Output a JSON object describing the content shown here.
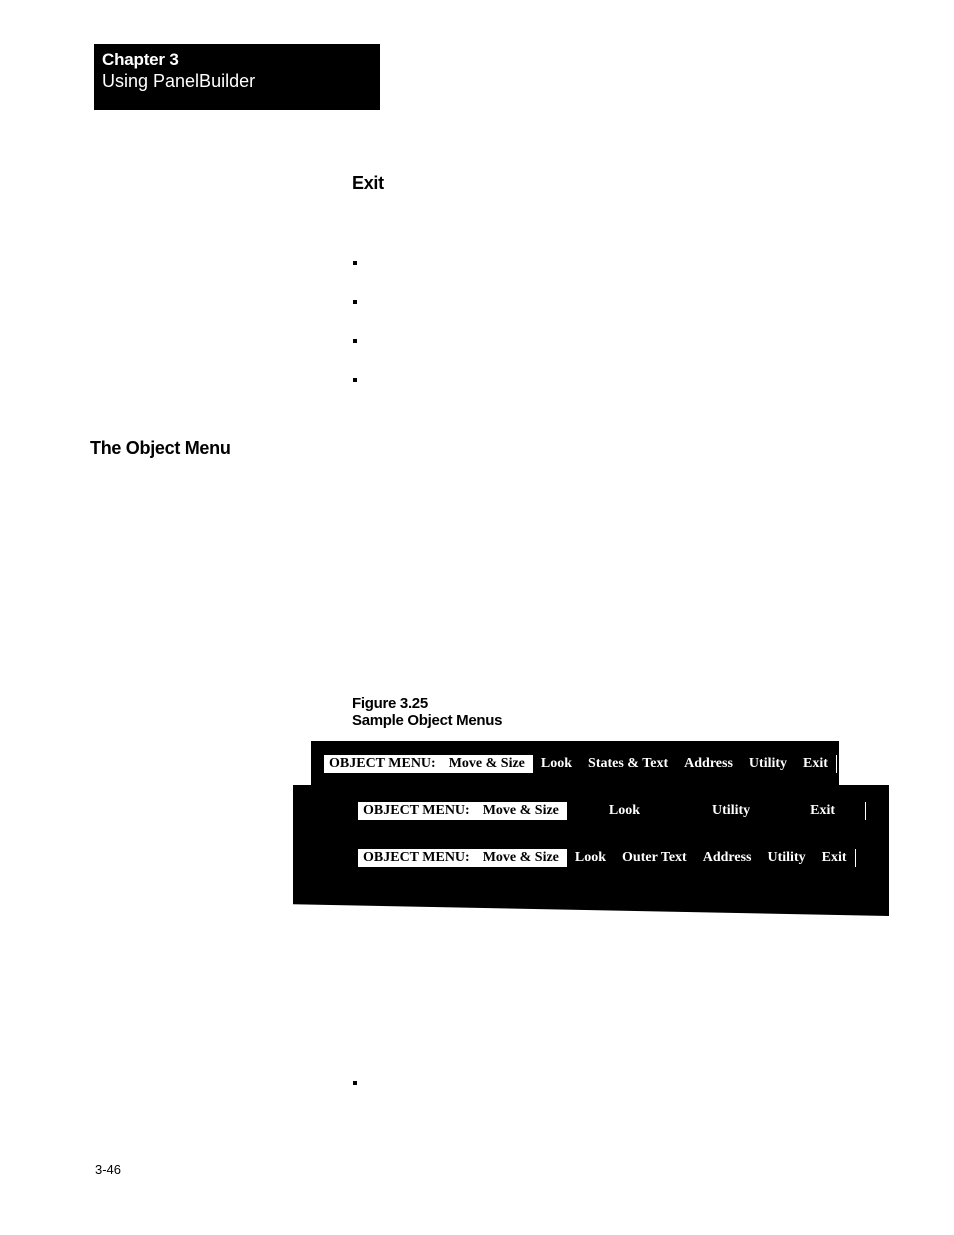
{
  "header": {
    "chapter": "Chapter 3",
    "subtitle": "Using PanelBuilder"
  },
  "exit_heading": "Exit",
  "object_menu_heading": "The Object Menu",
  "figure": {
    "number": "Figure 3.25",
    "caption": "Sample Object Menus"
  },
  "menubar1": {
    "label": "OBJECT MENU:",
    "items": [
      "Move & Size",
      "Look",
      "States & Text",
      "Address",
      "Utility",
      "Exit"
    ],
    "selected_index": 0
  },
  "menubar2": {
    "label": "OBJECT MENU:",
    "items": [
      "Move & Size",
      "Look",
      "Utility",
      "Exit"
    ],
    "selected_index": 0
  },
  "menubar3": {
    "label": "OBJECT MENU:",
    "items": [
      "Move & Size",
      "Look",
      "Outer Text",
      "Address",
      "Utility",
      "Exit"
    ],
    "selected_index": 0
  },
  "page_number": "3-46"
}
